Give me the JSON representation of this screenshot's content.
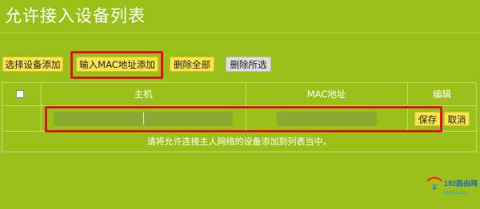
{
  "header": {
    "title": "允许接入设备列表"
  },
  "toolbar": {
    "select_add_label": "选择设备添加",
    "mac_add_label": "输入MAC地址添加",
    "delete_all_label": "删除全部",
    "delete_selected_label": "删除所选"
  },
  "table": {
    "columns": [
      "主机",
      "MAC地址",
      "编辑"
    ],
    "edit_row": {
      "host_value": "",
      "mac_value": "",
      "save_label": "保存",
      "cancel_label": "取消"
    },
    "empty_message": "请将允许连接主人网络的设备添加到列表当中。"
  },
  "watermark": {
    "brand": "192路由网",
    "site": "192ly.com"
  },
  "colors": {
    "background": "#9cc01a",
    "button_yellow": "#fbe44a",
    "button_grey": "#dedede",
    "highlight": "#e0141f",
    "input_fill": "#8aaa32"
  }
}
